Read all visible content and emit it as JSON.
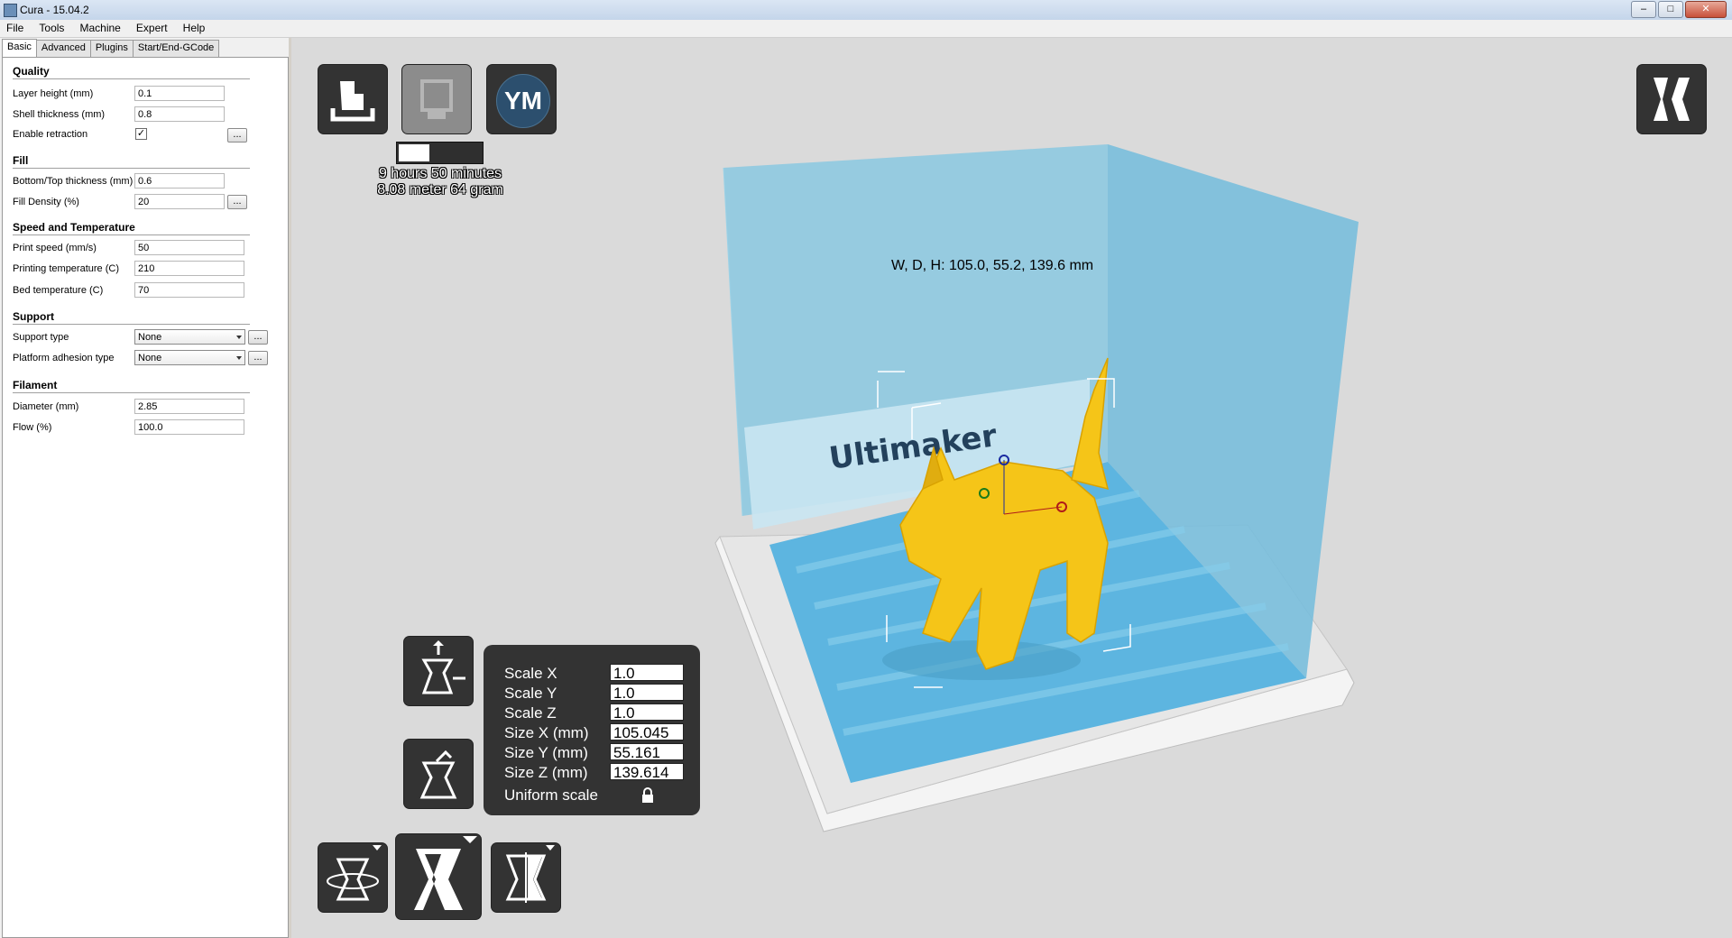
{
  "window": {
    "title": "Cura - 15.04.2"
  },
  "menu": [
    "File",
    "Tools",
    "Machine",
    "Expert",
    "Help"
  ],
  "tabs": [
    "Basic",
    "Advanced",
    "Plugins",
    "Start/End-GCode"
  ],
  "settings": {
    "quality": {
      "title": "Quality",
      "layer_height_label": "Layer height (mm)",
      "layer_height": "0.1",
      "shell_thickness_label": "Shell thickness (mm)",
      "shell_thickness": "0.8",
      "enable_retraction_label": "Enable retraction",
      "enable_retraction": true
    },
    "fill": {
      "title": "Fill",
      "bottom_top_label": "Bottom/Top thickness (mm)",
      "bottom_top": "0.6",
      "fill_density_label": "Fill Density (%)",
      "fill_density": "20"
    },
    "speed": {
      "title": "Speed and Temperature",
      "print_speed_label": "Print speed (mm/s)",
      "print_speed": "50",
      "print_temp_label": "Printing temperature (C)",
      "print_temp": "210",
      "bed_temp_label": "Bed temperature (C)",
      "bed_temp": "70"
    },
    "support": {
      "title": "Support",
      "support_type_label": "Support type",
      "support_type": "None",
      "adhesion_label": "Platform adhesion type",
      "adhesion": "None"
    },
    "filament": {
      "title": "Filament",
      "diameter_label": "Diameter (mm)",
      "diameter": "2.85",
      "flow_label": "Flow (%)",
      "flow": "100.0"
    },
    "dots_label": "..."
  },
  "viewport": {
    "ym_logo": "YM",
    "print_time": "9 hours 50 minutes",
    "print_material": "8.08 meter 64 gram",
    "progress": 0.37,
    "dimensions": "W, D, H: 105.0, 55.2, 139.6 mm",
    "plate_logo": "Ultimaker",
    "scale": {
      "scale_x_label": "Scale X",
      "scale_x": "1.0",
      "scale_y_label": "Scale Y",
      "scale_y": "1.0",
      "scale_z_label": "Scale Z",
      "scale_z": "1.0",
      "size_x_label": "Size X (mm)",
      "size_x": "105.045",
      "size_y_label": "Size Y (mm)",
      "size_y": "55.161",
      "size_z_label": "Size Z (mm)",
      "size_z": "139.614",
      "uniform_label": "Uniform scale"
    }
  },
  "colors": {
    "build_volume": "#7fc4e0",
    "model": "#f5c518",
    "tool_button": "#333333"
  },
  "icons": [
    "load-icon",
    "save-sd-icon",
    "view-mode-icon",
    "scale-icon",
    "mirror-icon",
    "rotate-icon",
    "lock-icon"
  ]
}
